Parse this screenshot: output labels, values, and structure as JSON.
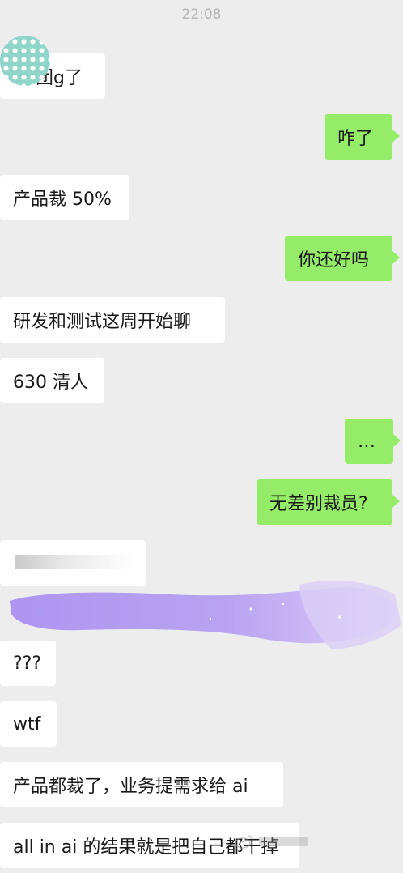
{
  "chat": {
    "timestamp": "22:08",
    "messages": [
      {
        "side": "in",
        "text": "团g了"
      },
      {
        "side": "out",
        "text": "咋了"
      },
      {
        "side": "in",
        "text": "产品裁 50%"
      },
      {
        "side": "out",
        "text": "你还好吗"
      },
      {
        "side": "in",
        "text": "研发和测试这周开始聊"
      },
      {
        "side": "in",
        "text": "630 清人"
      },
      {
        "side": "out",
        "text": "…"
      },
      {
        "side": "out",
        "text": "无差别裁员?"
      },
      {
        "side": "in",
        "text": ""
      },
      {
        "side": "in",
        "text": "???"
      },
      {
        "side": "in",
        "text": "wtf"
      },
      {
        "side": "in",
        "text": "产品都裁了，业务提需求给 ai"
      },
      {
        "side": "in",
        "text": "all in ai 的结果就是把自己都干掉"
      }
    ]
  },
  "colors": {
    "background": "#ededed",
    "incoming_bubble": "#ffffff",
    "outgoing_bubble": "#95ec69"
  }
}
